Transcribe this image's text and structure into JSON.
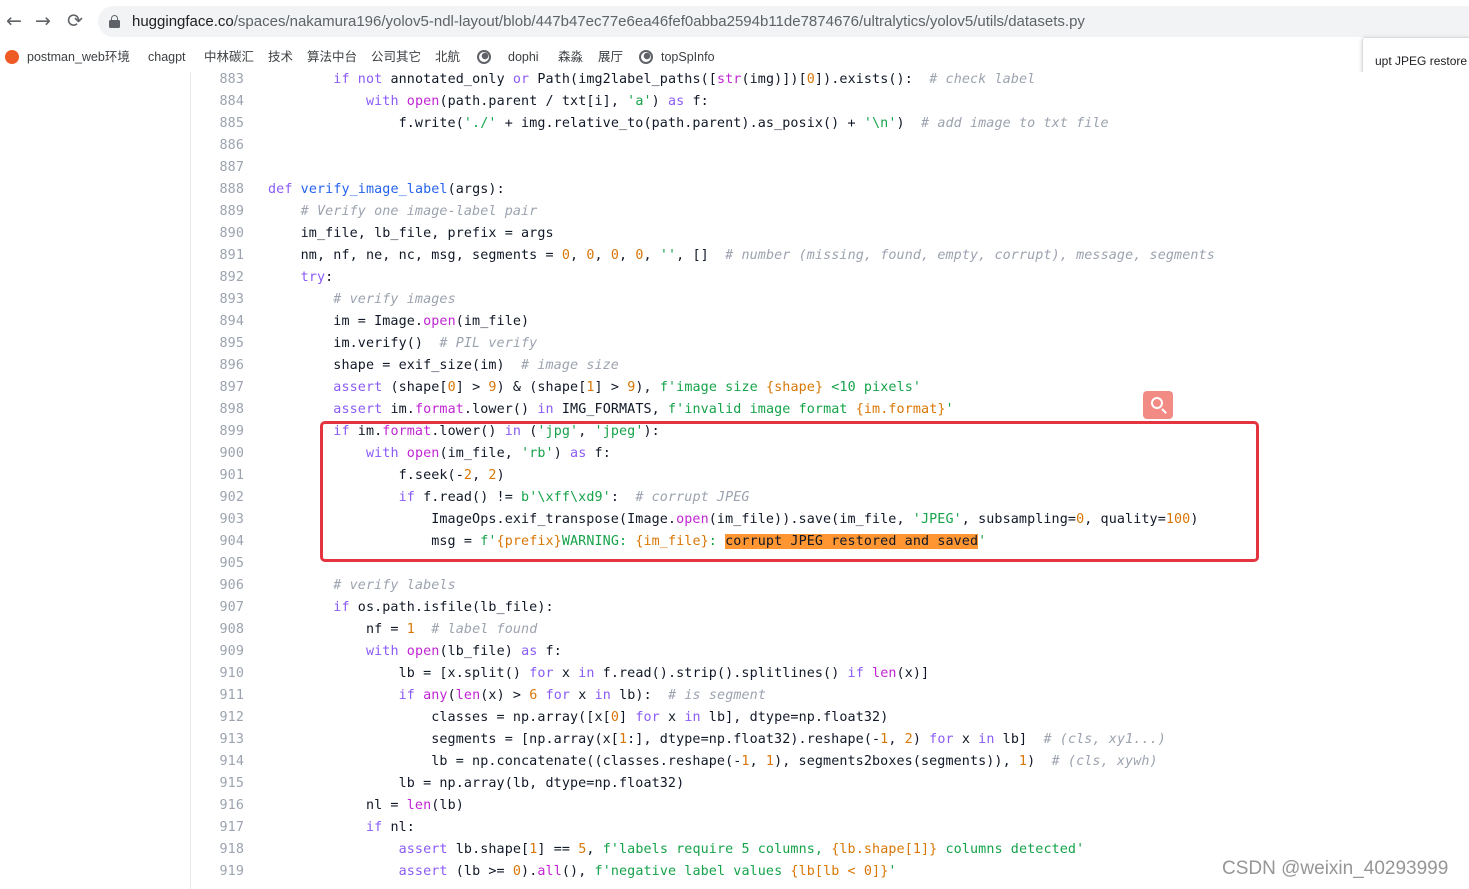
{
  "browser": {
    "url_host": "huggingface.co",
    "url_path": "/spaces/nakamura196/yolov5-ndl-layout/blob/447b47ec77e6ea46fef0abba2594b11de7874676/ultralytics/yolov5/utils/datasets.py",
    "back_icon": "←",
    "forward_icon": "→",
    "reload_icon": "⟳"
  },
  "bookmarks": [
    {
      "label": "postman_web环境",
      "icon": "postman-icon",
      "color": "#ef5b25"
    },
    {
      "label": "chagpt"
    },
    {
      "label": "中林碳汇"
    },
    {
      "label": "技术"
    },
    {
      "label": "算法中台"
    },
    {
      "label": "公司其它"
    },
    {
      "label": "北航"
    },
    {
      "label": "",
      "icon": "globe-icon",
      "color": "#5f6368"
    },
    {
      "label": "dophi"
    },
    {
      "label": "森淼"
    },
    {
      "label": "展厅"
    },
    {
      "label": "topSpInfo",
      "icon": "globe-icon",
      "color": "#5f6368"
    }
  ],
  "popup": {
    "text": "upt JPEG restore"
  },
  "code": {
    "lines": [
      {
        "n": "883",
        "html": "        <span class=\"kw\">if</span> <span class=\"kw\">not</span> annotated_only <span class=\"kw\">or</span> Path(img2label_paths([<span class=\"bi\">str</span>(img)])[<span class=\"num\">0</span>]).exists():  <span class=\"cm\"># check label</span>"
      },
      {
        "n": "884",
        "html": "            <span class=\"kw\">with</span> <span class=\"bi\">open</span>(path.parent / txt[i], <span class=\"str\">'a'</span>) <span class=\"kw\">as</span> f:"
      },
      {
        "n": "885",
        "html": "                f.write(<span class=\"str\">'./'</span> + img.relative_to(path.parent).as_posix() + <span class=\"str\">'\\n'</span>)  <span class=\"cm\"># add image to txt file</span>"
      },
      {
        "n": "886",
        "html": ""
      },
      {
        "n": "887",
        "html": ""
      },
      {
        "n": "888",
        "html": "<span class=\"kw\">def</span> <span class=\"fn\">verify_image_label</span>(args):"
      },
      {
        "n": "889",
        "html": "    <span class=\"cm\"># Verify one image-label pair</span>"
      },
      {
        "n": "890",
        "html": "    im_file, lb_file, prefix = args"
      },
      {
        "n": "891",
        "html": "    nm, nf, ne, nc, msg, segments = <span class=\"num\">0</span>, <span class=\"num\">0</span>, <span class=\"num\">0</span>, <span class=\"num\">0</span>, <span class=\"str\">''</span>, []  <span class=\"cm\"># number (missing, found, empty, corrupt), message, segments</span>"
      },
      {
        "n": "892",
        "html": "    <span class=\"kw\">try</span>:"
      },
      {
        "n": "893",
        "html": "        <span class=\"cm\"># verify images</span>"
      },
      {
        "n": "894",
        "html": "        im = Image.<span class=\"bi\">open</span>(im_file)"
      },
      {
        "n": "895",
        "html": "        im.verify()  <span class=\"cm\"># PIL verify</span>"
      },
      {
        "n": "896",
        "html": "        shape = exif_size(im)  <span class=\"cm\"># image size</span>"
      },
      {
        "n": "897",
        "html": "        <span class=\"kw\">assert</span> (shape[<span class=\"num\">0</span>] > <span class=\"num\">9</span>) & (shape[<span class=\"num\">1</span>] > <span class=\"num\">9</span>), <span class=\"str\">f'image size </span><span class=\"sub\">{shape}</span><span class=\"str\"> &lt;10 pixels'</span>"
      },
      {
        "n": "898",
        "html": "        <span class=\"kw\">assert</span> im.<span class=\"bi\">format</span>.lower() <span class=\"kw\">in</span> IMG_FORMATS, <span class=\"str\">f'invalid image format </span><span class=\"sub\">{im.format}</span><span class=\"str\">'</span>"
      },
      {
        "n": "899",
        "html": "        <span class=\"kw\">if</span> im.<span class=\"bi\">format</span>.lower() <span class=\"kw\">in</span> (<span class=\"str\">'jpg'</span>, <span class=\"str\">'jpeg'</span>):"
      },
      {
        "n": "900",
        "html": "            <span class=\"kw\">with</span> <span class=\"bi\">open</span>(im_file, <span class=\"str\">'rb'</span>) <span class=\"kw\">as</span> f:"
      },
      {
        "n": "901",
        "html": "                f.seek(-<span class=\"num\">2</span>, <span class=\"num\">2</span>)"
      },
      {
        "n": "902",
        "html": "                <span class=\"kw\">if</span> f.read() != <span class=\"str\">b'\\xff\\xd9'</span>:  <span class=\"cm\"># corrupt JPEG</span>"
      },
      {
        "n": "903",
        "html": "                    ImageOps.exif_transpose(Image.<span class=\"bi\">open</span>(im_file)).save(im_file, <span class=\"str\">'JPEG'</span>, subsampling=<span class=\"num\">0</span>, quality=<span class=\"num\">100</span>)"
      },
      {
        "n": "904",
        "html": "                    msg = <span class=\"str\">f'</span><span class=\"sub\">{prefix}</span><span class=\"str\">WARNING: </span><span class=\"sub\">{im_file}</span><span class=\"str\">: </span><span class=\"hl\">corrupt JPEG restored and saved</span><span class=\"str\">'</span>"
      },
      {
        "n": "905",
        "html": ""
      },
      {
        "n": "906",
        "html": "        <span class=\"cm\"># verify labels</span>"
      },
      {
        "n": "907",
        "html": "        <span class=\"kw\">if</span> os.path.isfile(lb_file):"
      },
      {
        "n": "908",
        "html": "            nf = <span class=\"num\">1</span>  <span class=\"cm\"># label found</span>"
      },
      {
        "n": "909",
        "html": "            <span class=\"kw\">with</span> <span class=\"bi\">open</span>(lb_file) <span class=\"kw\">as</span> f:"
      },
      {
        "n": "910",
        "html": "                lb = [x.split() <span class=\"kw\">for</span> x <span class=\"kw\">in</span> f.read().strip().splitlines() <span class=\"kw\">if</span> <span class=\"bi\">len</span>(x)]"
      },
      {
        "n": "911",
        "html": "                <span class=\"kw\">if</span> <span class=\"bi\">any</span>(<span class=\"bi\">len</span>(x) > <span class=\"num\">6</span> <span class=\"kw\">for</span> x <span class=\"kw\">in</span> lb):  <span class=\"cm\"># is segment</span>"
      },
      {
        "n": "912",
        "html": "                    classes = np.array([x[<span class=\"num\">0</span>] <span class=\"kw\">for</span> x <span class=\"kw\">in</span> lb], dtype=np.float32)"
      },
      {
        "n": "913",
        "html": "                    segments = [np.array(x[<span class=\"num\">1</span>:], dtype=np.float32).reshape(-<span class=\"num\">1</span>, <span class=\"num\">2</span>) <span class=\"kw\">for</span> x <span class=\"kw\">in</span> lb]  <span class=\"cm\"># (cls, xy1...)</span>"
      },
      {
        "n": "914",
        "html": "                    lb = np.concatenate((classes.reshape(-<span class=\"num\">1</span>, <span class=\"num\">1</span>), segments2boxes(segments)), <span class=\"num\">1</span>)  <span class=\"cm\"># (cls, xywh)</span>"
      },
      {
        "n": "915",
        "html": "                lb = np.array(lb, dtype=np.float32)"
      },
      {
        "n": "916",
        "html": "            nl = <span class=\"bi\">len</span>(lb)"
      },
      {
        "n": "917",
        "html": "            <span class=\"kw\">if</span> nl:"
      },
      {
        "n": "918",
        "html": "                <span class=\"kw\">assert</span> lb.shape[<span class=\"num\">1</span>] == <span class=\"num\">5</span>, <span class=\"str\">f'labels require 5 columns, </span><span class=\"sub\">{lb.shape[1]}</span><span class=\"str\"> columns detected'</span>"
      },
      {
        "n": "919",
        "html": "                <span class=\"kw\">assert</span> (lb >= <span class=\"num\">0</span>).<span class=\"bi\">all</span>(), <span class=\"str\">f'negative label values </span><span class=\"sub\">{lb[lb &lt; 0]}</span><span class=\"str\">'</span>"
      }
    ]
  },
  "watermark": "CSDN @weixin_40293999",
  "colors": {
    "highlight_border": "#e3343f",
    "match_highlight": "#ff9632",
    "search_button": "#f28b84"
  }
}
